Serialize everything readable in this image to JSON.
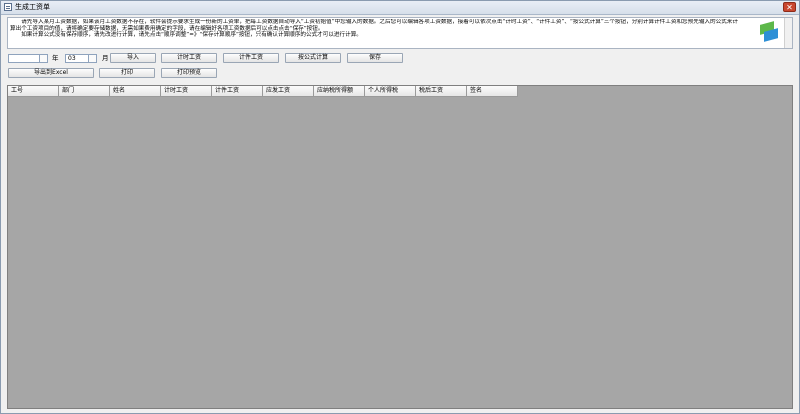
{
  "window": {
    "title": "生成工资单",
    "close_label": "✕"
  },
  "instructions": {
    "text": "　　请先导入某月工资数据，如果该月工资数据不存在，软件会提示要求生成一份新的工资单，把每工资数据自动导入“工资初始值”中您输入的数据。之后您可以编辑各项工资数据，接着可以依次点击“计时工资”、“计件工资”、“按公式计算”三个按钮，分别计算计件工资和您预先输入的公式来计算出个工资项目的值，请将确定要存储数据，无需如果费用确定的字段，请在编辑好各项工资数据后可以点击点击“保存”按钮。\n　　如果计算公式没有保存顺序，请先改进行计算，请先点击“顺序调整”=》“保存计算顺序”按钮，只有确认计算顺序的公式才可以进行计算。"
  },
  "controls": {
    "year_value": "",
    "year_label": "年",
    "month_value": "03",
    "month_label": "月",
    "import_label": "导入",
    "time_wage_label": "计时工资",
    "piece_wage_label": "计件工资",
    "formula_label": "按公式计算",
    "save_label": "保存",
    "export_excel_label": "导出到Excel",
    "print_label": "打印",
    "print_preview_label": "打印预览"
  },
  "grid": {
    "columns": [
      "工号",
      "部门",
      "姓名",
      "计时工资",
      "计件工资",
      "应发工资",
      "应纳税所得额",
      "个人所得税",
      "税后工资",
      "签名"
    ]
  },
  "colors": {
    "grid_background": "#a6a6a6",
    "title_bar": "#dfe6ef",
    "close_button": "#c9472f"
  }
}
